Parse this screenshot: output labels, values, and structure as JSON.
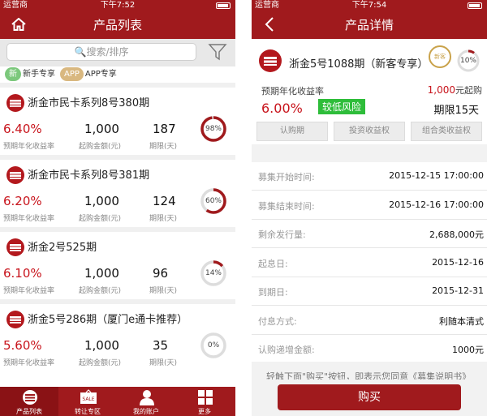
{
  "colors": {
    "brand": "#a01a1d",
    "rate_red": "#c8141c",
    "risk_green": "#2ebd3a",
    "ring_track": "#dddddd"
  },
  "left": {
    "status": {
      "carrier": "运营商",
      "time": "下午7:52"
    },
    "nav": {
      "title": "产品列表",
      "home_icon": "home-icon"
    },
    "search": {
      "placeholder": "🔍搜索/排序",
      "filter_icon": "filter-icon"
    },
    "tags": [
      {
        "badge": "新",
        "label": "新手专享"
      },
      {
        "badge": "APP",
        "label": "APP专享"
      }
    ],
    "labels": {
      "rate": "预期年化收益率",
      "amount": "起购金额(元)",
      "period": "期限(天)"
    },
    "products": [
      {
        "name": "浙金市民卡系列8号380期",
        "rate": "6.40%",
        "amount": "1,000",
        "period": "187",
        "progress_text": "98%",
        "progress": 0.98
      },
      {
        "name": "浙金市民卡系列8号381期",
        "rate": "6.20%",
        "amount": "1,000",
        "period": "124",
        "progress_text": "60%",
        "progress": 0.6
      },
      {
        "name": "浙金2号525期",
        "rate": "6.10%",
        "amount": "1,000",
        "period": "96",
        "progress_text": "14%",
        "progress": 0.14
      },
      {
        "name": "浙金5号286期（厦门e通卡推荐）",
        "rate": "5.60%",
        "amount": "1,000",
        "period": "35",
        "progress_text": "0%",
        "progress": 0.0
      }
    ],
    "tabs": [
      {
        "label": "产品列表",
        "icon": "product-list-icon",
        "sale": ""
      },
      {
        "label": "转让专区",
        "icon": "sale-tag-icon",
        "sale": "SALE"
      },
      {
        "label": "我的账户",
        "icon": "user-icon",
        "sale": ""
      },
      {
        "label": "更多",
        "icon": "grid-more-icon",
        "sale": ""
      }
    ]
  },
  "right": {
    "status": {
      "carrier": "运营商",
      "time": "下午7:54"
    },
    "nav": {
      "title": "产品详情",
      "back_icon": "back-chevron-icon"
    },
    "header": {
      "name": "浙金5号1088期（新客专享）",
      "badge_text": "新客",
      "progress_text": "10%",
      "progress": 0.1
    },
    "summary": {
      "rate_label": "预期年化收益率",
      "min_amount": "1,000",
      "min_suffix": "元起购",
      "rate": "6.00%",
      "risk": "较低风险",
      "term": "期限15天"
    },
    "buttons": [
      "认购期",
      "投资收益权",
      "组合类收益权"
    ],
    "rows": [
      {
        "key": "募集开始时间:",
        "value": "2015-12-15 17:00:00"
      },
      {
        "key": "募集结束时间:",
        "value": "2015-12-16 17:00:00"
      },
      {
        "key": "剩余发行量:",
        "value": "2,688,000元"
      },
      {
        "key": "起息日:",
        "value": "2015-12-16"
      },
      {
        "key": "到期日:",
        "value": "2015-12-31"
      },
      {
        "key": "付息方式:",
        "value": "利随本清式"
      },
      {
        "key": "认购递增金额:",
        "value": "1000元"
      }
    ],
    "note": "轻触下面\"购买\"按钮，即表示您同意《募集说明书》",
    "buy_label": "购买"
  }
}
